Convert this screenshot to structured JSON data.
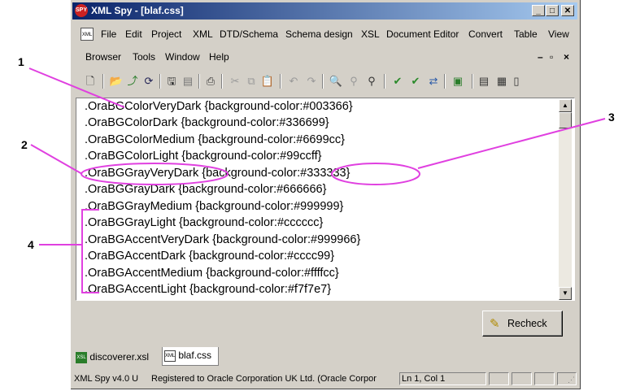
{
  "window": {
    "title": "XML Spy - [blaf.css]",
    "app_icon_text": "SPY"
  },
  "menu": {
    "row1": [
      "File",
      "Edit",
      "Project",
      "XML",
      "DTD/Schema",
      "Schema design",
      "XSL",
      "Document Editor",
      "Convert",
      "Table",
      "View"
    ],
    "row2": [
      "Browser",
      "Tools",
      "Window",
      "Help"
    ]
  },
  "editor": {
    "lines": [
      ".OraBGColorVeryDark {background-color:#003366}",
      ".OraBGColorDark {background-color:#336699}",
      ".OraBGColorMedium {background-color:#6699cc}",
      ".OraBGColorLight {background-color:#99ccff}",
      ".OraBGGrayVeryDark {background-color:#333333}",
      ".OraBGGrayDark {background-color:#666666}",
      ".OraBGGrayMedium {background-color:#999999}",
      ".OraBGGrayLight {background-color:#cccccc}",
      ".OraBGAccentVeryDark {background-color:#999966}",
      ".OraBGAccentDark {background-color:#cccc99}",
      ".OraBGAccentMedium {background-color:#ffffcc}",
      ".OraBGAccentLight {background-color:#f7f7e7}"
    ]
  },
  "recheck_label": "Recheck",
  "tabs": [
    {
      "label": "discoverer.xsl",
      "icon": "xsl-file-icon"
    },
    {
      "label": "blaf.css",
      "icon": "xml-file-icon"
    }
  ],
  "status": {
    "version": "XML Spy v4.0 U",
    "registration": "Registered to Oracle Corporation UK Ltd. (Oracle Corpor",
    "position": "Ln 1, Col 1"
  },
  "callouts": [
    "1",
    "2",
    "3",
    "4"
  ],
  "colors": {
    "title_gradient_start": "#0a246a",
    "title_gradient_end": "#a6caf0",
    "annotation": "#e040e0",
    "chrome": "#d4d0c8"
  }
}
